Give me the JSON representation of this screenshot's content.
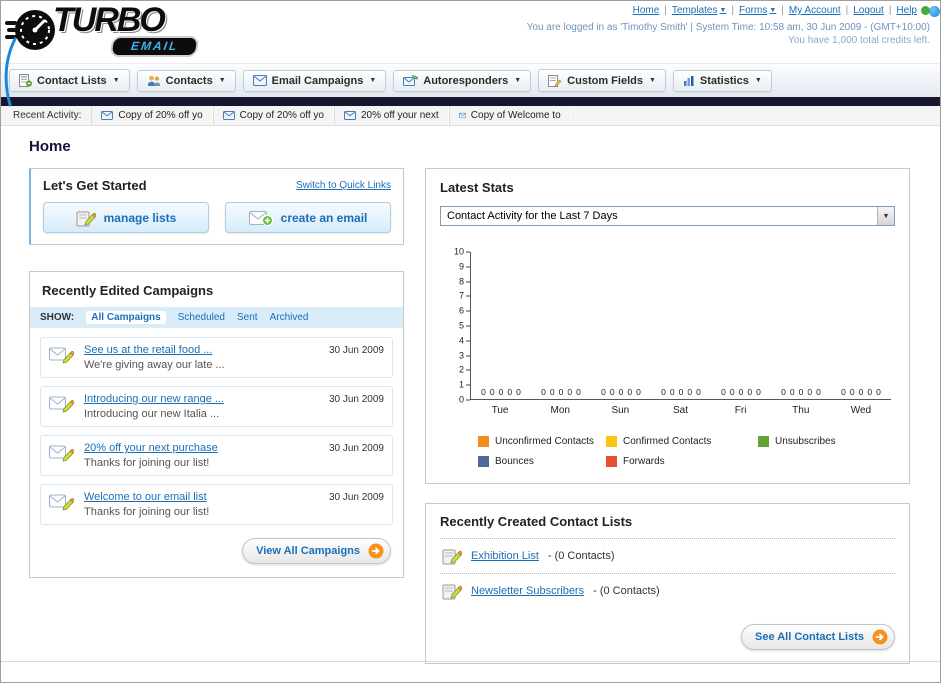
{
  "header": {
    "logo": {
      "turbo": "TURBO",
      "email": "EMAIL"
    },
    "separator": "|",
    "top_links": [
      "Home",
      "Templates",
      "Forms",
      "My Account",
      "Logout",
      "Help"
    ],
    "login_info": "You are logged in as 'Timothy Smith' | System Time: 10:58 am, 30 Jun 2009 - (GMT+10:00)",
    "credits_info": "You have 1,000 total credits left."
  },
  "nav": {
    "items": [
      {
        "label": "Contact Lists"
      },
      {
        "label": "Contacts"
      },
      {
        "label": "Email Campaigns"
      },
      {
        "label": "Autoresponders"
      },
      {
        "label": "Custom Fields"
      },
      {
        "label": "Statistics"
      }
    ]
  },
  "recent_activity": {
    "label": "Recent Activity:",
    "items": [
      "Copy of 20% off yo",
      "Copy of 20% off yo",
      "20% off your next",
      "Copy of Welcome to"
    ]
  },
  "page_title": "Home",
  "get_started": {
    "title": "Let's Get Started",
    "switch_link": "Switch to Quick Links",
    "manage_lists_label": "manage lists",
    "create_email_label": "create an email"
  },
  "campaigns": {
    "title": "Recently Edited Campaigns",
    "show_label": "SHOW:",
    "filters": [
      "All Campaigns",
      "Scheduled",
      "Sent",
      "Archived"
    ],
    "items": [
      {
        "title": "See us at the retail food ...",
        "subtitle": "We're giving away our late ...",
        "date": "30 Jun 2009"
      },
      {
        "title": "Introducing our new range ...",
        "subtitle": "Introducing our new Italia ...",
        "date": "30 Jun 2009"
      },
      {
        "title": "20% off your next purchase",
        "subtitle": "Thanks for joining our list!",
        "date": "30 Jun 2009"
      },
      {
        "title": "Welcome to our email list",
        "subtitle": "Thanks for joining our list!",
        "date": "30 Jun 2009"
      }
    ],
    "view_all_label": "View All Campaigns"
  },
  "stats": {
    "title": "Latest Stats",
    "dropdown_value": "Contact Activity for the Last 7 Days",
    "legend": [
      {
        "label": "Unconfirmed Contacts",
        "color": "#f68b1f"
      },
      {
        "label": "Confirmed Contacts",
        "color": "#fdc413"
      },
      {
        "label": "Unsubscribes",
        "color": "#64a235"
      },
      {
        "label": "Bounces",
        "color": "#50699b"
      },
      {
        "label": "Forwards",
        "color": "#e8502c"
      }
    ]
  },
  "chart_data": {
    "type": "bar",
    "title": "Contact Activity for the Last 7 Days",
    "categories": [
      "Tue",
      "Mon",
      "Sun",
      "Sat",
      "Fri",
      "Thu",
      "Wed"
    ],
    "series": [
      {
        "name": "Unconfirmed Contacts",
        "values": [
          0,
          0,
          0,
          0,
          0,
          0,
          0
        ]
      },
      {
        "name": "Confirmed Contacts",
        "values": [
          0,
          0,
          0,
          0,
          0,
          0,
          0
        ]
      },
      {
        "name": "Unsubscribes",
        "values": [
          0,
          0,
          0,
          0,
          0,
          0,
          0
        ]
      },
      {
        "name": "Bounces",
        "values": [
          0,
          0,
          0,
          0,
          0,
          0,
          0
        ]
      },
      {
        "name": "Forwards",
        "values": [
          0,
          0,
          0,
          0,
          0,
          0,
          0
        ]
      }
    ],
    "ylim": [
      0,
      10
    ],
    "yticks": [
      0,
      1,
      2,
      3,
      4,
      5,
      6,
      7,
      8,
      9,
      10
    ],
    "grid": false,
    "legend_position": "bottom"
  },
  "contact_lists": {
    "title": "Recently Created Contact Lists",
    "items": [
      {
        "name": "Exhibition List",
        "detail": "- (0 Contacts)"
      },
      {
        "name": "Newsletter Subscribers",
        "detail": "- (0 Contacts)"
      }
    ],
    "see_all_label": "See All Contact Lists"
  }
}
